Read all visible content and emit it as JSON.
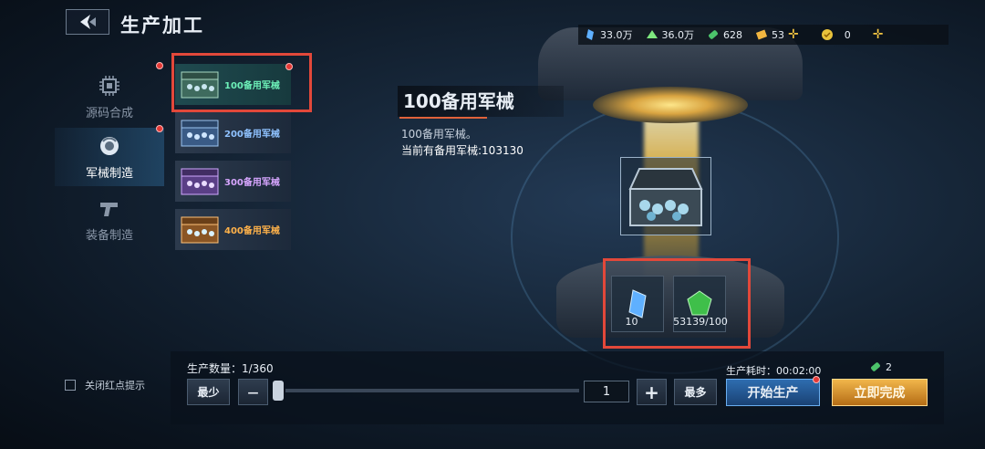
{
  "header": {
    "title": "生产加工"
  },
  "resources": [
    {
      "icon": "blue-crystal-icon",
      "value": "33.0万",
      "color": "#5fb0ff"
    },
    {
      "icon": "green-crystal-icon",
      "value": "36.0万",
      "color": "#7ee87e"
    },
    {
      "icon": "green-battery-icon",
      "value": "628",
      "color": "#4cc36b"
    },
    {
      "icon": "gold-ticket-icon",
      "value": "53",
      "color": "#f2b640"
    },
    {
      "icon": "gold-coin-icon",
      "value": "0",
      "color": "#e9c23b"
    }
  ],
  "nav": [
    {
      "label": "源码合成",
      "icon": "chip-icon"
    },
    {
      "label": "军械制造",
      "icon": "orb-icon"
    },
    {
      "label": "装备制造",
      "icon": "gun-icon"
    }
  ],
  "products": [
    {
      "label": "100备用军械",
      "color": "#6df0b8"
    },
    {
      "label": "200备用军械",
      "color": "#8fc2ff"
    },
    {
      "label": "300备用军械",
      "color": "#d7a6ff"
    },
    {
      "label": "400备用军械",
      "color": "#ffb24a"
    }
  ],
  "detail": {
    "title": "100备用军械",
    "description": "100备用军械。",
    "current": "当前有备用军械:103130"
  },
  "materials": [
    {
      "icon": "blue-crystal-icon",
      "amount": "10"
    },
    {
      "icon": "green-gem-icon",
      "amount": "53139/100"
    }
  ],
  "production": {
    "quantity_label": "生产数量：1/360",
    "min_label": "最少",
    "minus_label": "—",
    "quantity_value": "1",
    "plus_label": "+",
    "max_label": "最多",
    "quantity_fraction": 0.0028,
    "time_label": "生产耗时：00:02:00",
    "cost_value": "2",
    "start_label": "开始生产",
    "finish_label": "立即完成"
  },
  "settings": {
    "toggle_label": "关闭红点提示"
  }
}
